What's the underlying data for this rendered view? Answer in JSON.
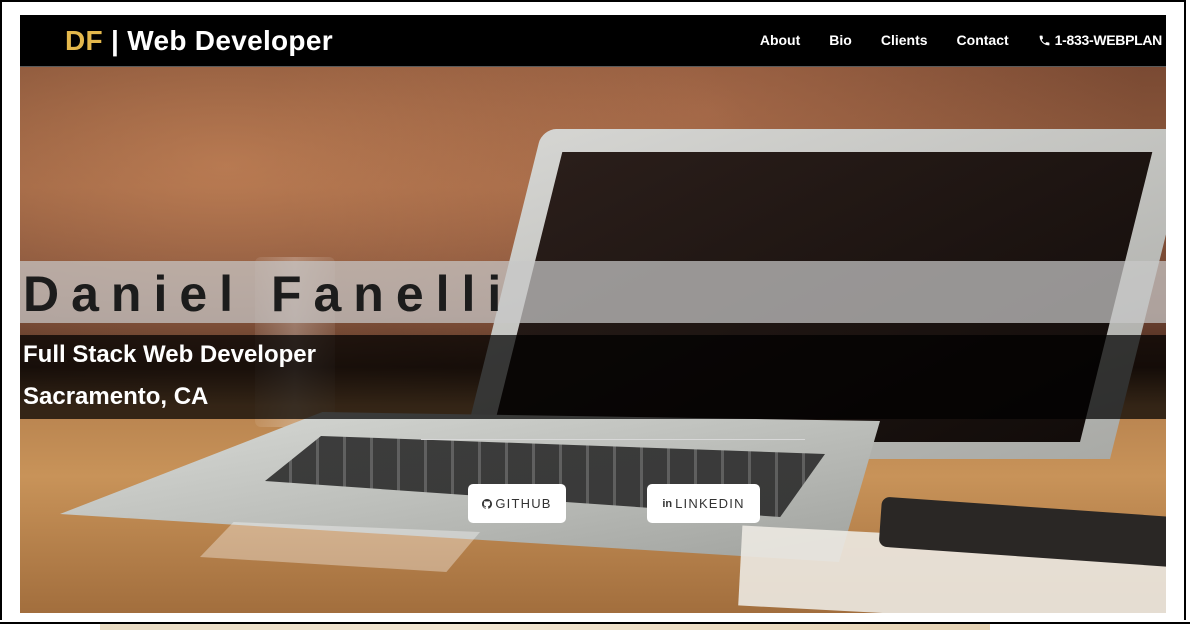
{
  "navbar": {
    "brand_initials": "DF",
    "brand_rest": " | Web Developer",
    "links": [
      "About",
      "Bio",
      "Clients",
      "Contact"
    ],
    "phone": "1-833-WEBPLAN"
  },
  "hero": {
    "name": "Daniel Fanelli",
    "role": "Full Stack Web Developer",
    "location": "Sacramento, CA",
    "buttons": {
      "github_label": "GITHUB",
      "linkedin_label": "LINKEDIN",
      "linkedin_icon_text": "in"
    }
  },
  "icons": {
    "phone": "phone-icon",
    "github": "github-icon",
    "linkedin": "linkedin-icon"
  },
  "colors": {
    "brand_accent": "#e4b84c",
    "navbar_bg": "#000000"
  }
}
